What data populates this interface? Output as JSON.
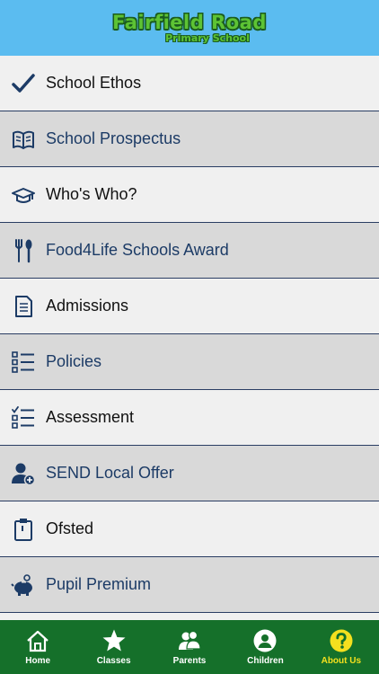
{
  "header": {
    "title": "Fairfield Road",
    "subtitle": "Primary School"
  },
  "menu": [
    {
      "label": "School Ethos",
      "icon": "checkmark-icon"
    },
    {
      "label": "School Prospectus",
      "icon": "book-icon"
    },
    {
      "label": "Who's Who?",
      "icon": "graduation-cap-icon"
    },
    {
      "label": "Food4Life Schools Award",
      "icon": "fork-spoon-icon"
    },
    {
      "label": "Admissions",
      "icon": "document-icon"
    },
    {
      "label": "Policies",
      "icon": "checkbox-list-icon"
    },
    {
      "label": "Assessment",
      "icon": "checklist-icon"
    },
    {
      "label": "SEND Local Offer",
      "icon": "add-user-icon"
    },
    {
      "label": "Ofsted",
      "icon": "clipboard-icon"
    },
    {
      "label": "Pupil Premium",
      "icon": "piggy-bank-icon"
    }
  ],
  "tabs": [
    {
      "label": "Home",
      "icon": "home-icon"
    },
    {
      "label": "Classes",
      "icon": "star-icon"
    },
    {
      "label": "Parents",
      "icon": "users-icon"
    },
    {
      "label": "Children",
      "icon": "child-icon"
    },
    {
      "label": "About Us",
      "icon": "question-icon",
      "active": true
    }
  ],
  "colors": {
    "header": "#5bbcf0",
    "tabbar": "#15702a",
    "active_tab": "#f4e01e",
    "icon": "#1c3b66"
  }
}
